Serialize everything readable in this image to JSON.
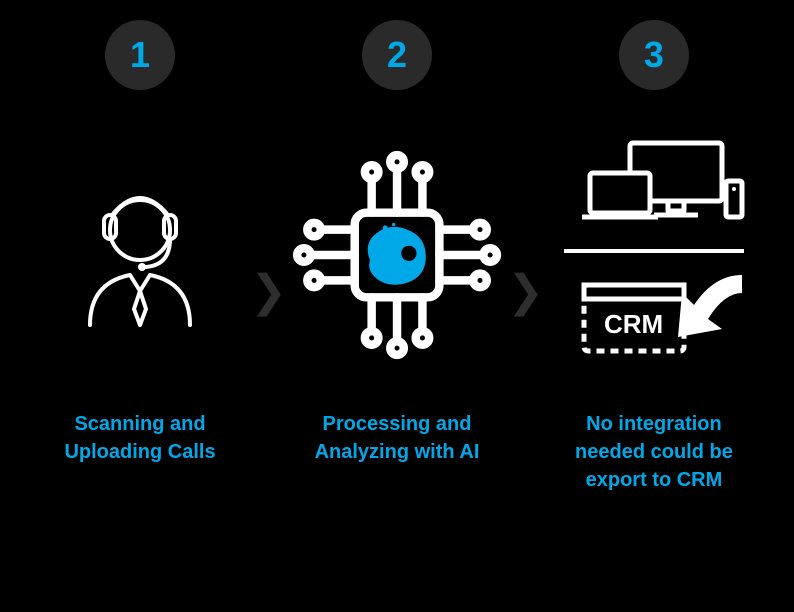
{
  "steps": [
    {
      "num": "1",
      "caption": "Scanning and Uploading Calls"
    },
    {
      "num": "2",
      "caption": "Processing and Analyzing with AI"
    },
    {
      "num": "3",
      "caption": "No integration needed could be export to CRM"
    }
  ],
  "crm_label": "CRM",
  "colors": {
    "accent": "#00a8e8",
    "bg": "#000",
    "badge": "#2a2a2a",
    "arrow": "#2e2e2e",
    "icon": "#ffffff"
  }
}
